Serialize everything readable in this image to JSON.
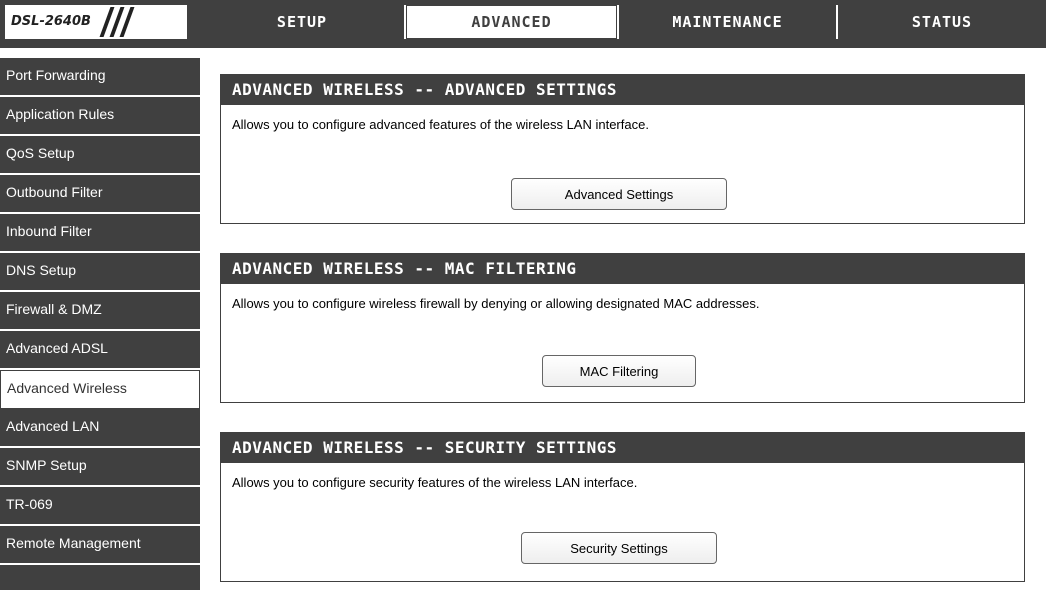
{
  "brand": {
    "model": "DSL-2640B"
  },
  "tabs": [
    {
      "label": "SETUP"
    },
    {
      "label": "ADVANCED"
    },
    {
      "label": "MAINTENANCE"
    },
    {
      "label": "STATUS"
    }
  ],
  "sidebar": {
    "items": [
      {
        "label": "Port Forwarding"
      },
      {
        "label": "Application Rules"
      },
      {
        "label": "QoS Setup"
      },
      {
        "label": "Outbound Filter"
      },
      {
        "label": "Inbound Filter"
      },
      {
        "label": "DNS Setup"
      },
      {
        "label": "Firewall & DMZ"
      },
      {
        "label": "Advanced ADSL"
      },
      {
        "label": "Advanced Wireless"
      },
      {
        "label": "Advanced LAN"
      },
      {
        "label": "SNMP Setup"
      },
      {
        "label": "TR-069"
      },
      {
        "label": "Remote Management"
      }
    ]
  },
  "panels": [
    {
      "title": "ADVANCED WIRELESS -- ADVANCED SETTINGS",
      "description": "Allows you to configure advanced features of the wireless LAN interface.",
      "button": "Advanced Settings"
    },
    {
      "title": "ADVANCED WIRELESS -- MAC FILTERING",
      "description": "Allows you to configure wireless firewall by denying or allowing designated MAC addresses.",
      "button": "MAC Filtering"
    },
    {
      "title": "ADVANCED WIRELESS -- SECURITY SETTINGS",
      "description": "Allows you to configure security features of the wireless LAN interface.",
      "button": "Security Settings"
    }
  ],
  "colors": {
    "dark": "#404040",
    "active_bg": "#ffffff"
  }
}
